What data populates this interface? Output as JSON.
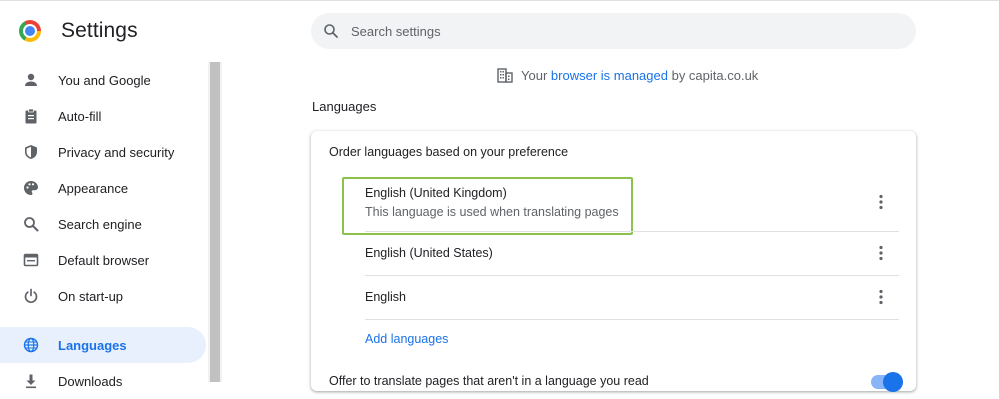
{
  "app": {
    "title": "Settings"
  },
  "search": {
    "placeholder": "Search settings",
    "value": ""
  },
  "managed": {
    "prefix": "Your ",
    "link": "browser is managed",
    "suffix": " by capita.co.uk"
  },
  "sidebar": {
    "items": [
      {
        "label": "You and Google",
        "icon": "person-icon"
      },
      {
        "label": "Auto-fill",
        "icon": "clipboard-icon"
      },
      {
        "label": "Privacy and security",
        "icon": "shield-icon"
      },
      {
        "label": "Appearance",
        "icon": "palette-icon"
      },
      {
        "label": "Search engine",
        "icon": "search-icon"
      },
      {
        "label": "Default browser",
        "icon": "browser-icon"
      },
      {
        "label": "On start-up",
        "icon": "power-icon"
      },
      {
        "label": "Languages",
        "icon": "globe-icon",
        "active": true
      },
      {
        "label": "Downloads",
        "icon": "download-icon"
      }
    ]
  },
  "languages": {
    "section_title": "Languages",
    "order_label": "Order languages based on your preference",
    "list": [
      {
        "name": "English (United Kingdom)",
        "description": "This language is used when translating pages"
      },
      {
        "name": "English (United States)"
      },
      {
        "name": "English"
      }
    ],
    "add_label": "Add languages",
    "offer_translate_label": "Offer to translate pages that aren't in a language you read",
    "offer_translate_enabled": true
  },
  "colors": {
    "accent": "#1a73e8",
    "highlight_border": "#8bc34a",
    "active_nav_bg": "#e8f0fe"
  }
}
